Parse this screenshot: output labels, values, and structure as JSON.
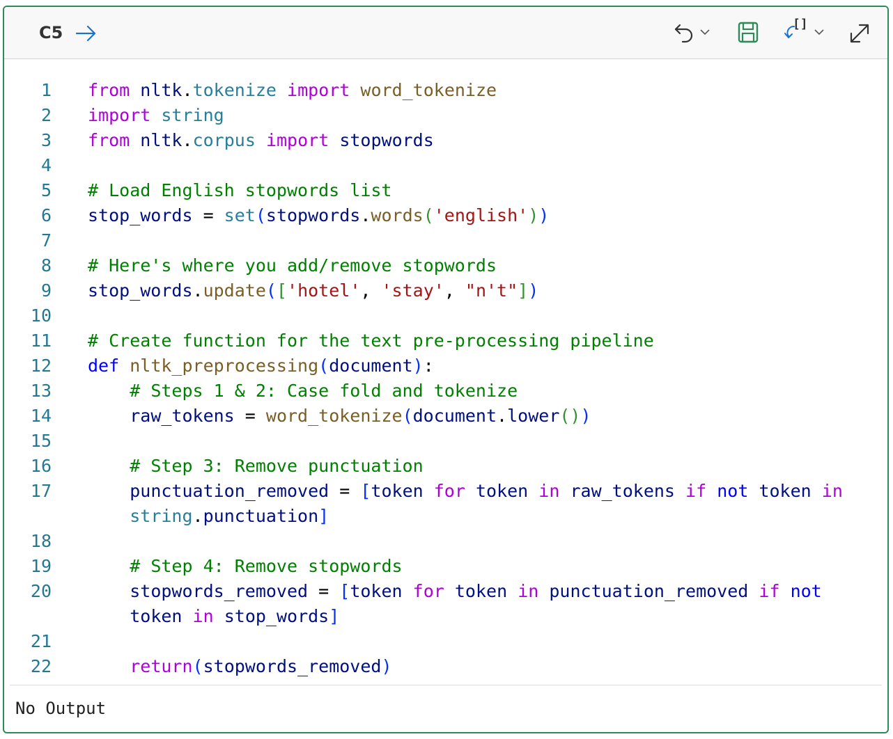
{
  "cell": {
    "label": "C5"
  },
  "toolbar": {
    "run_icon": "arrow-right-icon",
    "undo_icon": "undo-icon",
    "save_icon": "save-icon",
    "brackets_label": "[]",
    "expand_icon": "expand-icon"
  },
  "code_lines": [
    {
      "n": "1",
      "tokens": [
        [
          "k",
          "from"
        ],
        [
          "p",
          " "
        ],
        [
          "v",
          "nltk"
        ],
        [
          "p",
          "."
        ],
        [
          "m",
          "tokenize"
        ],
        [
          "p",
          " "
        ],
        [
          "k",
          "import"
        ],
        [
          "p",
          " "
        ],
        [
          "f",
          "word_tokenize"
        ]
      ]
    },
    {
      "n": "2",
      "tokens": [
        [
          "k",
          "import"
        ],
        [
          "p",
          " "
        ],
        [
          "m",
          "string"
        ]
      ]
    },
    {
      "n": "3",
      "tokens": [
        [
          "k",
          "from"
        ],
        [
          "p",
          " "
        ],
        [
          "v",
          "nltk"
        ],
        [
          "p",
          "."
        ],
        [
          "m",
          "corpus"
        ],
        [
          "p",
          " "
        ],
        [
          "k",
          "import"
        ],
        [
          "p",
          " "
        ],
        [
          "v",
          "stopwords"
        ]
      ]
    },
    {
      "n": "4",
      "tokens": []
    },
    {
      "n": "5",
      "tokens": [
        [
          "c",
          "# Load English stopwords list"
        ]
      ]
    },
    {
      "n": "6",
      "tokens": [
        [
          "v",
          "stop_words"
        ],
        [
          "p",
          " = "
        ],
        [
          "m",
          "set"
        ],
        [
          "b1",
          "("
        ],
        [
          "v",
          "stopwords"
        ],
        [
          "p",
          "."
        ],
        [
          "f",
          "words"
        ],
        [
          "b2",
          "("
        ],
        [
          "s",
          "'english'"
        ],
        [
          "b2",
          ")"
        ],
        [
          "b1",
          ")"
        ]
      ]
    },
    {
      "n": "7",
      "tokens": []
    },
    {
      "n": "8",
      "tokens": [
        [
          "c",
          "# Here's where you add/remove stopwords"
        ]
      ]
    },
    {
      "n": "9",
      "tokens": [
        [
          "v",
          "stop_words"
        ],
        [
          "p",
          "."
        ],
        [
          "f",
          "update"
        ],
        [
          "b1",
          "("
        ],
        [
          "b2",
          "["
        ],
        [
          "s",
          "'hotel'"
        ],
        [
          "p",
          ", "
        ],
        [
          "s",
          "'stay'"
        ],
        [
          "p",
          ", "
        ],
        [
          "s",
          "\"n't\""
        ],
        [
          "b2",
          "]"
        ],
        [
          "b1",
          ")"
        ]
      ]
    },
    {
      "n": "10",
      "tokens": []
    },
    {
      "n": "11",
      "tokens": [
        [
          "c",
          "# Create function for the text pre-processing pipeline"
        ]
      ]
    },
    {
      "n": "12",
      "tokens": [
        [
          "kd",
          "def"
        ],
        [
          "p",
          " "
        ],
        [
          "f",
          "nltk_preprocessing"
        ],
        [
          "b1",
          "("
        ],
        [
          "v",
          "document"
        ],
        [
          "b1",
          ")"
        ],
        [
          "p",
          ":"
        ]
      ]
    },
    {
      "n": "13",
      "tokens": [
        [
          "p",
          "    "
        ],
        [
          "c",
          "# Steps 1 & 2: Case fold and tokenize"
        ]
      ]
    },
    {
      "n": "14",
      "tokens": [
        [
          "p",
          "    "
        ],
        [
          "v",
          "raw_tokens"
        ],
        [
          "p",
          " = "
        ],
        [
          "f",
          "word_tokenize"
        ],
        [
          "b1",
          "("
        ],
        [
          "v",
          "document"
        ],
        [
          "p",
          "."
        ],
        [
          "v",
          "lower"
        ],
        [
          "b2",
          "()"
        ],
        [
          "b1",
          ")"
        ]
      ]
    },
    {
      "n": "15",
      "tokens": []
    },
    {
      "n": "16",
      "tokens": [
        [
          "p",
          "    "
        ],
        [
          "c",
          "# Step 3: Remove punctuation"
        ]
      ]
    },
    {
      "n": "17",
      "tokens": [
        [
          "p",
          "    "
        ],
        [
          "v",
          "punctuation_removed"
        ],
        [
          "p",
          " = "
        ],
        [
          "b1",
          "["
        ],
        [
          "v",
          "token"
        ],
        [
          "p",
          " "
        ],
        [
          "k",
          "for"
        ],
        [
          "p",
          " "
        ],
        [
          "v",
          "token"
        ],
        [
          "p",
          " "
        ],
        [
          "k",
          "in"
        ],
        [
          "p",
          " "
        ],
        [
          "v",
          "raw_tokens"
        ],
        [
          "p",
          " "
        ],
        [
          "k",
          "if"
        ],
        [
          "p",
          " "
        ],
        [
          "kd",
          "not"
        ],
        [
          "p",
          " "
        ],
        [
          "v",
          "token"
        ],
        [
          "p",
          " "
        ],
        [
          "k",
          "in"
        ]
      ]
    },
    {
      "n": "",
      "tokens": [
        [
          "p",
          "    "
        ],
        [
          "m",
          "string"
        ],
        [
          "p",
          "."
        ],
        [
          "v",
          "punctuation"
        ],
        [
          "b1",
          "]"
        ]
      ]
    },
    {
      "n": "18",
      "tokens": []
    },
    {
      "n": "19",
      "tokens": [
        [
          "p",
          "    "
        ],
        [
          "c",
          "# Step 4: Remove stopwords"
        ]
      ]
    },
    {
      "n": "20",
      "tokens": [
        [
          "p",
          "    "
        ],
        [
          "v",
          "stopwords_removed"
        ],
        [
          "p",
          " = "
        ],
        [
          "b1",
          "["
        ],
        [
          "v",
          "token"
        ],
        [
          "p",
          " "
        ],
        [
          "k",
          "for"
        ],
        [
          "p",
          " "
        ],
        [
          "v",
          "token"
        ],
        [
          "p",
          " "
        ],
        [
          "k",
          "in"
        ],
        [
          "p",
          " "
        ],
        [
          "v",
          "punctuation_removed"
        ],
        [
          "p",
          " "
        ],
        [
          "k",
          "if"
        ],
        [
          "p",
          " "
        ],
        [
          "kd",
          "not"
        ]
      ]
    },
    {
      "n": "",
      "tokens": [
        [
          "p",
          "    "
        ],
        [
          "v",
          "token"
        ],
        [
          "p",
          " "
        ],
        [
          "k",
          "in"
        ],
        [
          "p",
          " "
        ],
        [
          "v",
          "stop_words"
        ],
        [
          "b1",
          "]"
        ]
      ]
    },
    {
      "n": "21",
      "tokens": []
    },
    {
      "n": "22",
      "tokens": [
        [
          "p",
          "    "
        ],
        [
          "k",
          "return"
        ],
        [
          "b1",
          "("
        ],
        [
          "v",
          "stopwords_removed"
        ],
        [
          "b1",
          ")"
        ]
      ]
    }
  ],
  "output": {
    "text": "No Output"
  }
}
